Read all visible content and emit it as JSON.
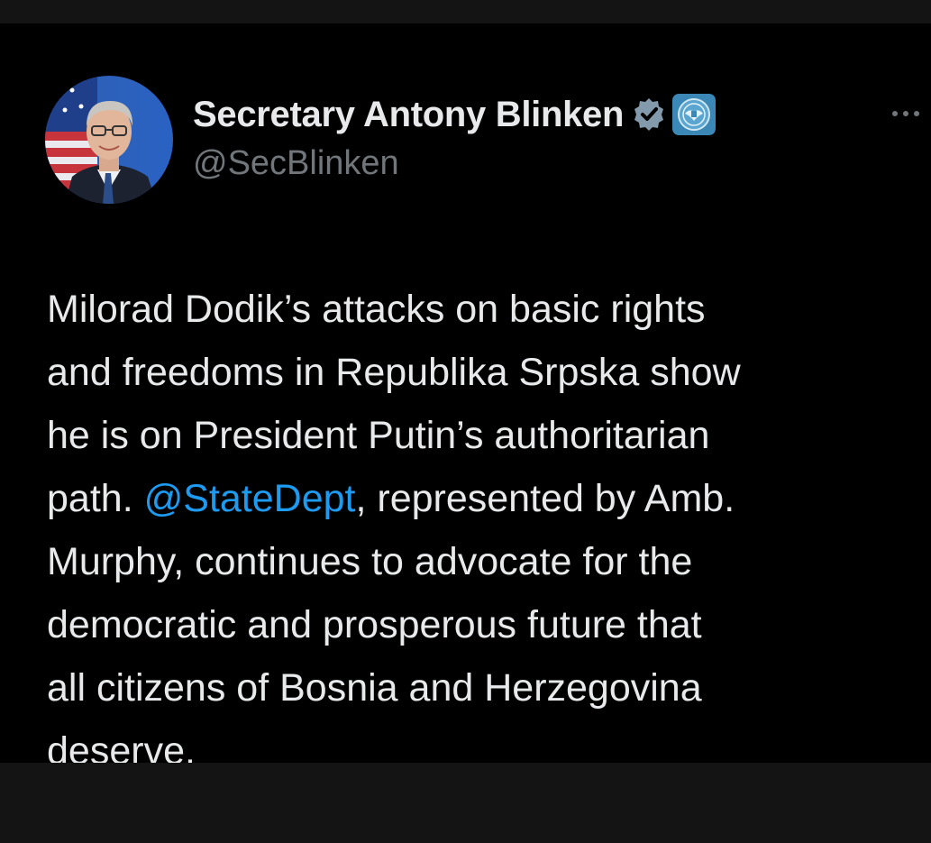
{
  "author": {
    "display_name": "Secretary Antony Blinken",
    "handle": "@SecBlinken",
    "verified_icon": "verified-badge-icon",
    "affiliate_icon": "us-state-department-seal-icon",
    "avatar_icon": "profile-photo"
  },
  "more_icon": "more-options-icon",
  "tweet": {
    "lines": [
      {
        "text": "Milorad Dodik’s attacks on basic rights"
      },
      {
        "text": "and freedoms in Republika Srpska show"
      },
      {
        "text": "he is on President Putin’s authoritarian"
      },
      {
        "before": "path. ",
        "mention": "@StateDept",
        "after": ", represented by Amb."
      },
      {
        "text": "Murphy, continues to advocate for the"
      },
      {
        "text": "democratic and prosperous future that"
      },
      {
        "text": "all citizens of Bosnia and Herzegovina"
      },
      {
        "text": "deserve."
      }
    ]
  },
  "colors": {
    "background": "#000000",
    "frame": "#141414",
    "text": "#e7e9ea",
    "secondary_text": "#71767b",
    "link": "#1d9bf0"
  }
}
